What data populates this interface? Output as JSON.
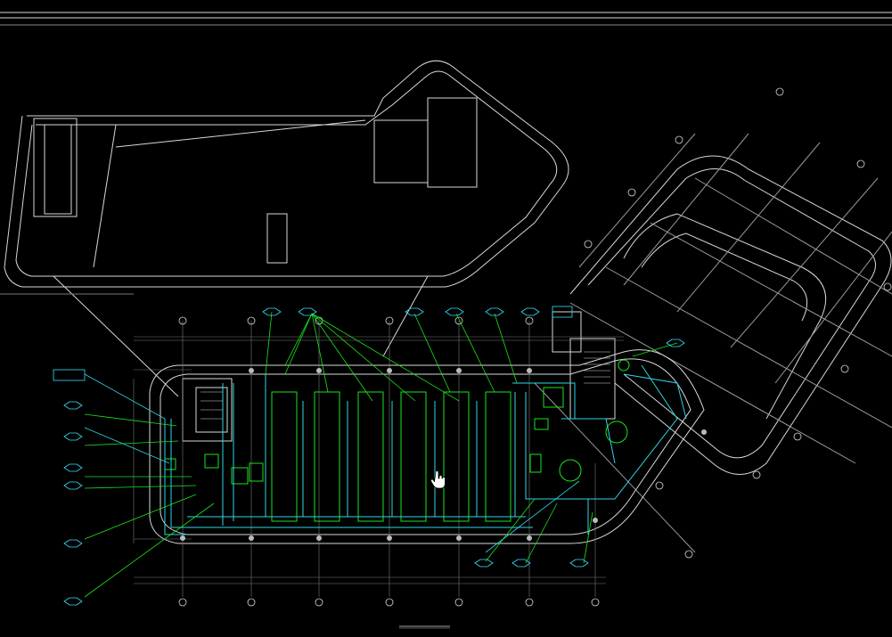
{
  "drawing_title": "",
  "scale_note": "",
  "colors": {
    "background": "#000000",
    "outline": "#d8d8d8",
    "pipe_green": "#19e619",
    "pipe_cyan": "#2fd6e6",
    "text_cyan": "#35e0ff",
    "text_yellow": "#e8e85a",
    "grid": "#8a8a8a"
  },
  "grid_bubbles_bottom": [
    "",
    "",
    "",
    "",
    "",
    "",
    "",
    "",
    "",
    "",
    ""
  ],
  "icons": {
    "cursor": "hand-pointer-icon",
    "bubble": "grid-axis-bubble-icon",
    "tag": "equipment-tag-hexagon-icon"
  }
}
